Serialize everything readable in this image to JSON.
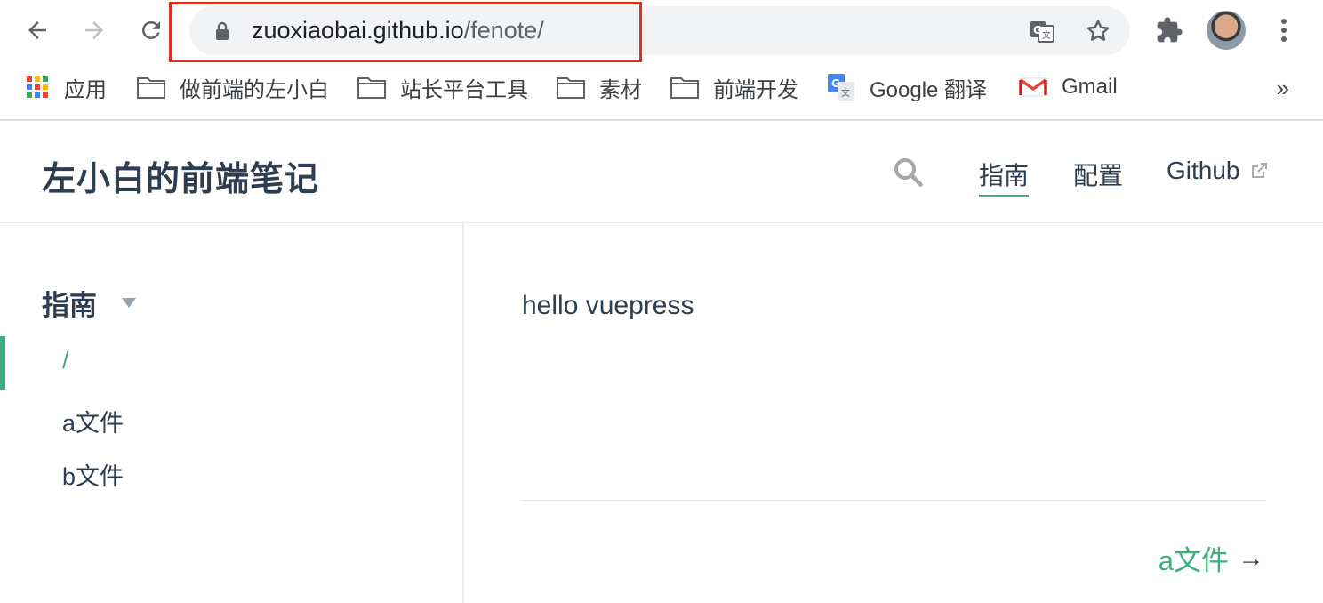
{
  "browser": {
    "url_host": "zuoxiaobai.github.io",
    "url_path": "/fenote/",
    "highlight_color": "#e0321f",
    "nav_icons": [
      "back-arrow-icon",
      "forward-arrow-icon",
      "reload-icon"
    ],
    "omnibox_icons": [
      "lock-icon",
      "translate-icon",
      "star-icon"
    ],
    "toolbar_icons": [
      "extensions-icon",
      "avatar",
      "more-icon"
    ]
  },
  "bookmarks": {
    "items": [
      {
        "label": "应用",
        "icon": "apps-grid-icon"
      },
      {
        "label": "做前端的左小白",
        "icon": "folder-icon"
      },
      {
        "label": "站长平台工具",
        "icon": "folder-icon"
      },
      {
        "label": "素材",
        "icon": "folder-icon"
      },
      {
        "label": "前端开发",
        "icon": "folder-icon"
      },
      {
        "label": "Google 翻译",
        "icon": "google-translate-icon"
      },
      {
        "label": "Gmail",
        "icon": "gmail-icon"
      }
    ],
    "overflow": "»"
  },
  "site": {
    "title": "左小白的前端笔记",
    "nav": [
      {
        "label": "指南",
        "active": true
      },
      {
        "label": "配置",
        "active": false
      },
      {
        "label": "Github",
        "external": true
      }
    ]
  },
  "sidebar": {
    "group_title": "指南",
    "items": [
      {
        "label": "/",
        "active": true
      },
      {
        "label": "a文件",
        "active": false
      },
      {
        "label": "b文件",
        "active": false
      }
    ]
  },
  "content": {
    "text": "hello vuepress",
    "next_link": "a文件",
    "next_arrow": "→"
  },
  "colors": {
    "accent": "#3eaf7c",
    "text": "#2c3e50"
  }
}
